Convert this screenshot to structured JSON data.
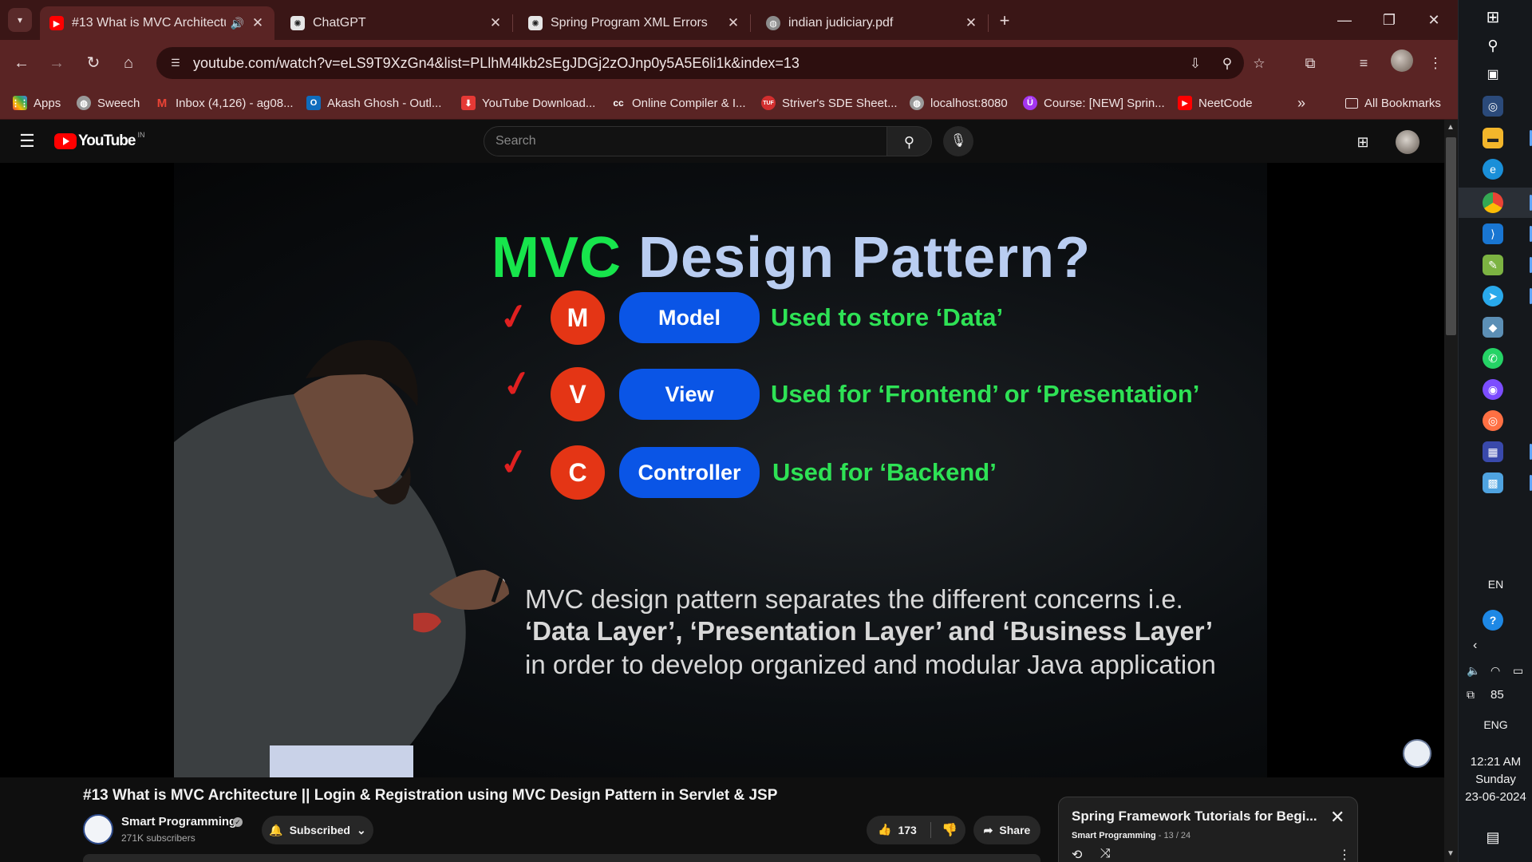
{
  "browser": {
    "tabs": [
      {
        "title": "#13 What is MVC Architectu",
        "favicon": "youtube-icon",
        "active": true,
        "audio": true
      },
      {
        "title": "ChatGPT",
        "favicon": "chatgpt-icon",
        "active": false
      },
      {
        "title": "Spring Program XML Errors",
        "favicon": "chatgpt-icon",
        "active": false
      },
      {
        "title": "indian judiciary.pdf",
        "favicon": "globe-icon",
        "active": false
      }
    ],
    "url": "youtube.com/watch?v=eLS9T9XzGn4&list=PLlhM4lkb2sEgJDGj2zOJnp0y5A5E6li1k&index=13",
    "bookmarks": [
      {
        "label": "Apps",
        "icon": "apps-grid-icon"
      },
      {
        "label": "Sweech",
        "icon": "globe-icon"
      },
      {
        "label": "Inbox (4,126) - ag08...",
        "icon": "gmail-icon"
      },
      {
        "label": "Akash Ghosh - Outl...",
        "icon": "outlook-icon"
      },
      {
        "label": "YouTube Download...",
        "icon": "download-icon"
      },
      {
        "label": "Online Compiler & I...",
        "icon": "cc-icon"
      },
      {
        "label": "Striver's SDE Sheet...",
        "icon": "tuf-icon"
      },
      {
        "label": "localhost:8080",
        "icon": "globe-icon"
      },
      {
        "label": "Course: [NEW] Sprin...",
        "icon": "udemy-icon"
      },
      {
        "label": "NeetCode",
        "icon": "youtube-icon"
      }
    ],
    "all_bookmarks": "All Bookmarks",
    "overflow": "»"
  },
  "youtube": {
    "logo_text": "YouTube",
    "logo_country": "IN",
    "search_placeholder": "Search",
    "slide": {
      "title_green": "MVC",
      "title_rest": "Design Pattern?",
      "rows": [
        {
          "letter": "M",
          "pill": "Model",
          "desc": "Used to store ‘Data’"
        },
        {
          "letter": "V",
          "pill": "View",
          "desc": "Used for ‘Frontend’ or ‘Presentation’"
        },
        {
          "letter": "C",
          "pill": "Controller",
          "desc": "Used for ‘Backend’"
        }
      ],
      "line1": "MVC design pattern separates the different concerns i.e.",
      "line2": "‘Data Layer’, ‘Presentation Layer’ and ‘Business Layer’",
      "line3": "in order to develop organized and modular Java application"
    },
    "video_title": "#13 What is MVC Architecture || Login & Registration using MVC Design Pattern in Servlet & JSP",
    "channel_name": "Smart Programming",
    "subscribers": "271K subscribers",
    "subscribed_label": "Subscribed",
    "likes": "173",
    "share_label": "Share",
    "playlist": {
      "title": "Spring Framework Tutorials for Begi...",
      "channel": "Smart Programming",
      "position": "13 / 24"
    }
  },
  "taskbar": {
    "language": "EN",
    "volume_percent": "85",
    "input_lang": "ENG",
    "time": "12:21 AM",
    "day": "Sunday",
    "date": "23-06-2024"
  },
  "colors": {
    "tabstrip": "#3a1616",
    "toolbar": "#5a2424",
    "yt_red": "#ff0000",
    "slide_green": "#17e54c",
    "slide_blue": "#0a55e6",
    "slide_orange": "#e43515"
  }
}
